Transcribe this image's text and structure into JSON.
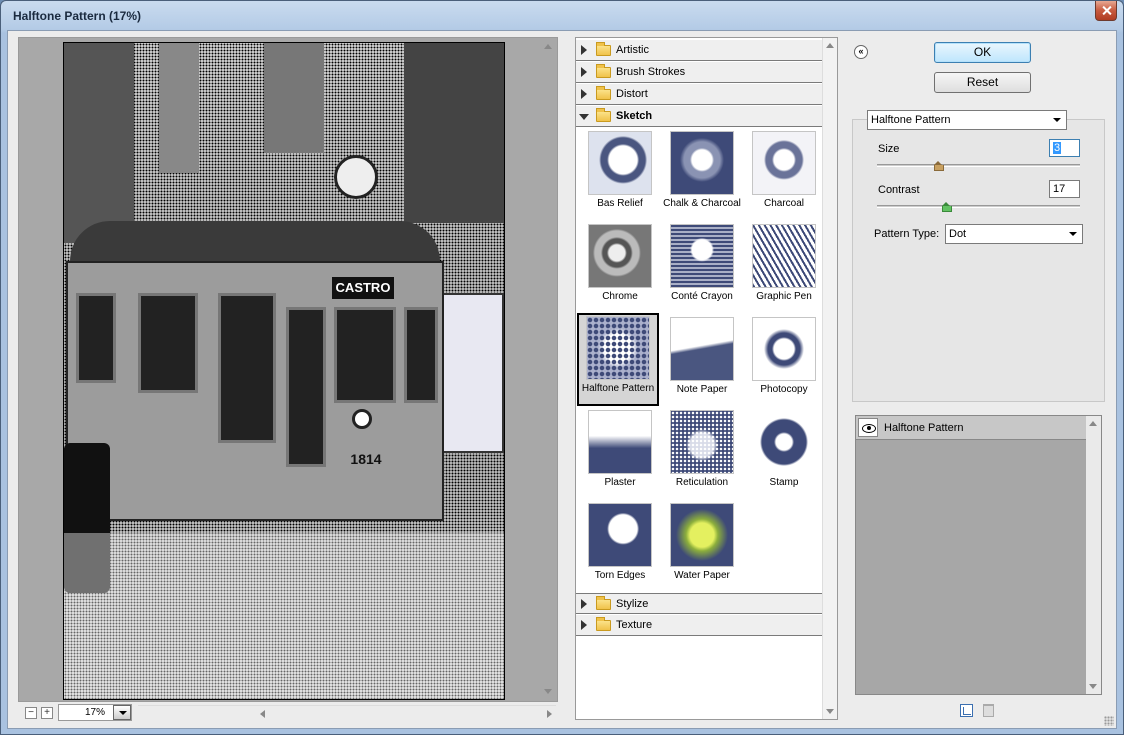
{
  "window": {
    "title": "Halftone Pattern (17%)"
  },
  "preview": {
    "sign_text": "CASTRO",
    "tram_number": "1814",
    "zoom_value": "17%",
    "zoom_out_label": "−",
    "zoom_in_label": "+"
  },
  "gallery": {
    "categories_top": [
      {
        "label": "Artistic",
        "expanded": false
      },
      {
        "label": "Brush Strokes",
        "expanded": false
      },
      {
        "label": "Distort",
        "expanded": false
      },
      {
        "label": "Sketch",
        "expanded": true
      }
    ],
    "filters": [
      {
        "label": "Bas Relief",
        "icon": "bas-relief-thumbnail"
      },
      {
        "label": "Chalk & Charcoal",
        "icon": "chalk-charcoal-thumbnail"
      },
      {
        "label": "Charcoal",
        "icon": "charcoal-thumbnail"
      },
      {
        "label": "Chrome",
        "icon": "chrome-thumbnail"
      },
      {
        "label": "Conté Crayon",
        "icon": "conte-crayon-thumbnail"
      },
      {
        "label": "Graphic Pen",
        "icon": "graphic-pen-thumbnail"
      },
      {
        "label": "Halftone Pattern",
        "icon": "halftone-pattern-thumbnail",
        "selected": true
      },
      {
        "label": "Note Paper",
        "icon": "note-paper-thumbnail"
      },
      {
        "label": "Photocopy",
        "icon": "photocopy-thumbnail"
      },
      {
        "label": "Plaster",
        "icon": "plaster-thumbnail"
      },
      {
        "label": "Reticulation",
        "icon": "reticulation-thumbnail"
      },
      {
        "label": "Stamp",
        "icon": "stamp-thumbnail"
      },
      {
        "label": "Torn Edges",
        "icon": "torn-edges-thumbnail"
      },
      {
        "label": "Water Paper",
        "icon": "water-paper-thumbnail"
      }
    ],
    "categories_bottom": [
      {
        "label": "Stylize",
        "expanded": false
      },
      {
        "label": "Texture",
        "expanded": false
      }
    ]
  },
  "buttons": {
    "ok": "OK",
    "reset": "Reset",
    "collapse": "«"
  },
  "settings": {
    "filter_select": "Halftone Pattern",
    "size_label": "Size",
    "size_value": "3",
    "size_level": 0.3,
    "contrast_label": "Contrast",
    "contrast_value": "17",
    "contrast_level": 0.34,
    "pattern_type_label": "Pattern Type:",
    "pattern_type_value": "Dot"
  },
  "layers": {
    "items": [
      {
        "label": "Halftone Pattern",
        "visible": true
      }
    ]
  },
  "colors": {
    "window_chrome": "#b4cbe6",
    "default_button": "#bee6fd",
    "selected_thumb_border": "#000000"
  }
}
